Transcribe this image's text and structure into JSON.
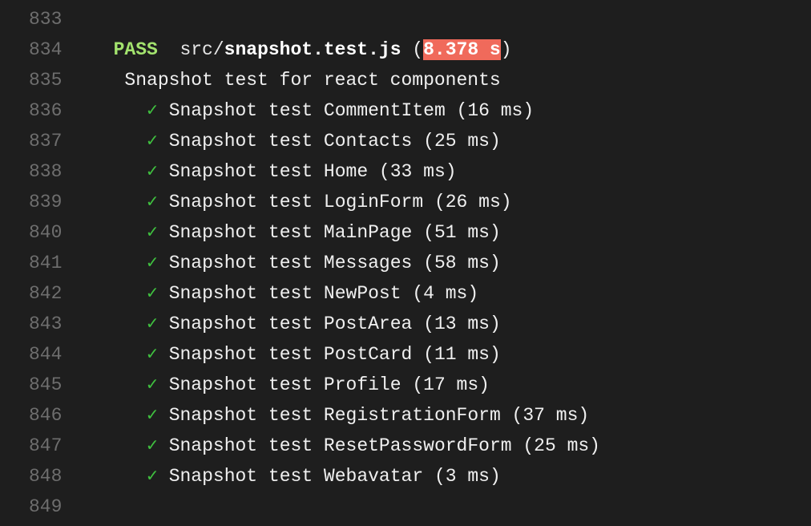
{
  "colors": {
    "background": "#1e1e1e",
    "line_number": "#6e6e6e",
    "pass": "#a3e36e",
    "check": "#3fbf3f",
    "slow_duration_bg": "#f06a5b"
  },
  "icons": {
    "check": "check-icon"
  },
  "header": {
    "line_number": "834",
    "status": "PASS",
    "path_dir": "src/",
    "path_file": "snapshot.test.js",
    "open_paren": " (",
    "duration": "8.378 s",
    "close_paren": ")"
  },
  "suite": {
    "line_number": "835",
    "name": "Snapshot test for react components"
  },
  "top_line_number": "833",
  "bottom_line_number": "849",
  "tests": [
    {
      "line_number": "836",
      "check": "✓",
      "text": "Snapshot test CommentItem (16 ms)"
    },
    {
      "line_number": "837",
      "check": "✓",
      "text": "Snapshot test Contacts (25 ms)"
    },
    {
      "line_number": "838",
      "check": "✓",
      "text": "Snapshot test Home (33 ms)"
    },
    {
      "line_number": "839",
      "check": "✓",
      "text": "Snapshot test LoginForm (26 ms)"
    },
    {
      "line_number": "840",
      "check": "✓",
      "text": "Snapshot test MainPage (51 ms)"
    },
    {
      "line_number": "841",
      "check": "✓",
      "text": "Snapshot test Messages (58 ms)"
    },
    {
      "line_number": "842",
      "check": "✓",
      "text": "Snapshot test NewPost (4 ms)"
    },
    {
      "line_number": "843",
      "check": "✓",
      "text": "Snapshot test PostArea (13 ms)"
    },
    {
      "line_number": "844",
      "check": "✓",
      "text": "Snapshot test PostCard (11 ms)"
    },
    {
      "line_number": "845",
      "check": "✓",
      "text": "Snapshot test Profile (17 ms)"
    },
    {
      "line_number": "846",
      "check": "✓",
      "text": "Snapshot test RegistrationForm (37 ms)"
    },
    {
      "line_number": "847",
      "check": "✓",
      "text": "Snapshot test ResetPasswordForm (25 ms)"
    },
    {
      "line_number": "848",
      "check": "✓",
      "text": "Snapshot test Webavatar (3 ms)"
    }
  ]
}
